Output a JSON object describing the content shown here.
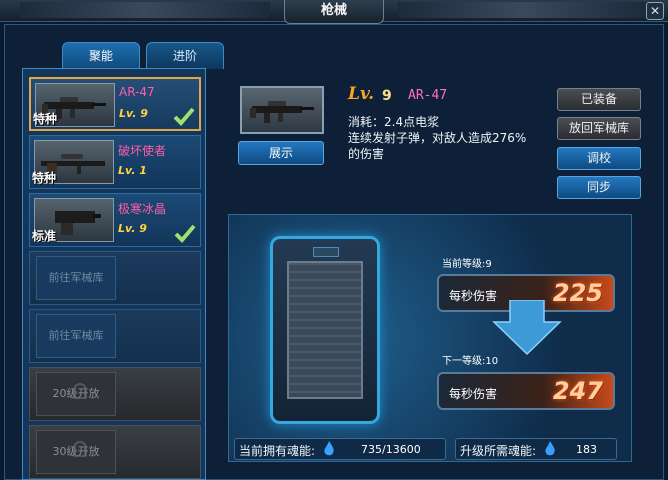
{
  "window": {
    "title": "枪械",
    "close_label": "✕"
  },
  "tabs": [
    {
      "label": "聚能"
    },
    {
      "label": "进阶"
    }
  ],
  "weapons": [
    {
      "tag": "特种",
      "name": "AR-47",
      "level": "Lv. 9",
      "equipped": true
    },
    {
      "tag": "特种",
      "name": "破坏使者",
      "level": "Lv. 1",
      "equipped": false
    },
    {
      "tag": "标准",
      "name": "极寒冰晶",
      "level": "Lv. 9",
      "equipped": true
    }
  ],
  "locked_slots": [
    "前往军械库",
    "前往军械库",
    "20级开放",
    "30级开放"
  ],
  "detail": {
    "show_button": "展示",
    "lv_label": "Lv.",
    "lv_num": "9",
    "gun_name": "AR-47",
    "desc_line1": "消耗：2.4点电浆",
    "desc_line2": "连续发射子弹，对敌人造成276%",
    "desc_line3": "的伤害"
  },
  "actions": {
    "equipped": "已装备",
    "return": "放回军械库",
    "tune": "调校",
    "sync": "同步"
  },
  "upgrade": {
    "current_label": "当前等级:9",
    "next_label": "下一等级:10",
    "dps_label": "每秒伤害",
    "current_dps": "225",
    "next_dps": "247"
  },
  "souls": {
    "owned_label": "当前拥有魂能:",
    "owned_value": "735/13600",
    "need_label": "升级所需魂能:",
    "need_value": "183"
  },
  "colors": {
    "accent": "#3f8ac4",
    "pink": "#ff5ea8",
    "gold": "#ffd23e"
  }
}
